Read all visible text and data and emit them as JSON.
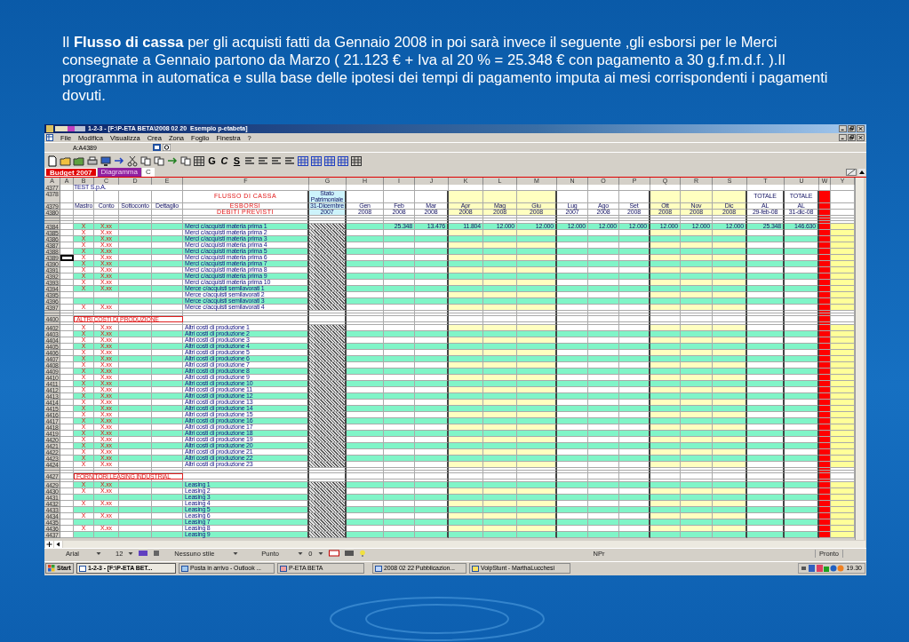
{
  "intro": "Il **Flusso di cassa** per gli acquisti fatti da Gennaio 2008 in poi sarà invece il seguente ,gli esborsi per le Merci consegnate a Gennaio partono da Marzo ( 21.123 € + Iva al 20 % = 25.348 € con pagamento a 30 g.f.m.d.f. ).Il programma in automatica e sulla base delle ipotesi dei tempi di pagamento imputa ai mesi corrispondenti i pagamenti dovuti.",
  "window": {
    "title": "1-2-3 - [F:\\P-ETA BETA\\2008 02 20  Esempio p-etabeta]"
  },
  "menu": [
    "File",
    "Modifica",
    "Visualizza",
    "Crea",
    "Zona",
    "Foglio",
    "Finestra",
    "?"
  ],
  "address": "A:A4389",
  "format_buttons": [
    "G",
    "C",
    "S"
  ],
  "sheet_tabs": [
    {
      "label": "Budget 2007",
      "selected": true,
      "color": "#e00000"
    },
    {
      "label": "Diagramma",
      "selected": false,
      "color": "#9020a0"
    },
    {
      "label": "C",
      "selected": false,
      "color": "#ffffff"
    }
  ],
  "column_headers": [
    "A",
    "A",
    "B",
    "C",
    "D",
    "E",
    "F",
    "G",
    "H",
    "I",
    "J",
    "K",
    "L",
    "M",
    "N",
    "O",
    "P",
    "Q",
    "R",
    "S",
    "T",
    "U",
    "W",
    "Y"
  ],
  "rows": [
    {
      "n": "4377",
      "kind": "title",
      "cells": {
        "B": "TEST S.p.A."
      }
    },
    {
      "n": "4378",
      "kind": "caption",
      "cells": {
        "F": "FLUSSO DI CASSA",
        "G": "Stato Patrimoniale",
        "T": "TOTALE",
        "U": "TOTALE"
      }
    },
    {
      "n": "4379",
      "kind": "header",
      "cells": {
        "B": "Mastro",
        "C": "Conto",
        "D": "Sottoconto",
        "E": "Dettaglio",
        "F": "ESBORSI",
        "G": "31-Dicembre",
        "H": "Gen",
        "I": "Feb",
        "J": "Mar",
        "K": "Apr",
        "L": "Mag",
        "M": "Giu",
        "N": "Lug",
        "O": "Ago",
        "P": "Set",
        "Q": "Ott",
        "R": "Nov",
        "S": "Dic",
        "T": "AL",
        "U": "AL"
      }
    },
    {
      "n": "4380",
      "kind": "header",
      "cells": {
        "F": "DEBITI PREVISTI",
        "G": "2007",
        "H": "2008",
        "I": "2008",
        "J": "2008",
        "K": "2008",
        "L": "2008",
        "M": "2008",
        "N": "2007",
        "O": "2008",
        "P": "2008",
        "Q": "2008",
        "R": "2008",
        "S": "2008",
        "T": "29-feb-08",
        "U": "31-dic-08"
      }
    },
    {
      "kind": "gap"
    },
    {
      "kind": "gap"
    },
    {
      "kind": "gap"
    },
    {
      "n": "4384",
      "kind": "data",
      "highlighted": true,
      "selected": false,
      "cells": {
        "B": "X",
        "C": "X.xx",
        "F": "Merci c/acquisti materia prima 1",
        "I": "25.348",
        "J": "13.476",
        "K": "11.804",
        "L": "12.000",
        "M": "12.000",
        "N": "12.000",
        "O": "12.000",
        "P": "12.000",
        "Q": "12.000",
        "R": "12.000",
        "S": "12.000",
        "T": "25.348",
        "U": "146.630"
      }
    },
    {
      "n": "4385",
      "kind": "data",
      "highlighted": false,
      "selected": false,
      "cells": {
        "B": "X",
        "C": "X.xx",
        "F": "Merci c/acquisti materia prima 2"
      }
    },
    {
      "n": "4386",
      "kind": "data",
      "highlighted": true,
      "selected": false,
      "cells": {
        "B": "X",
        "C": "X.xx",
        "F": "Merci c/acquisti materia prima 3"
      }
    },
    {
      "n": "4387",
      "kind": "data",
      "highlighted": false,
      "selected": false,
      "cells": {
        "B": "X",
        "C": "X.xx",
        "F": "Merci c/acquisti materia prima 4"
      }
    },
    {
      "n": "4388",
      "kind": "data",
      "highlighted": true,
      "selected": false,
      "cells": {
        "B": "X",
        "C": "X.xx",
        "F": "Merci c/acquisti materia prima 5"
      }
    },
    {
      "n": "4389",
      "kind": "data",
      "highlighted": false,
      "selected": true,
      "cells": {
        "B": "X",
        "C": "X.xx",
        "F": "Merci c/acquisti materia prima 6"
      }
    },
    {
      "n": "4390",
      "kind": "data",
      "highlighted": true,
      "selected": false,
      "cells": {
        "B": "X",
        "C": "X.xx",
        "F": "Merci c/acquisti materia prima 7"
      }
    },
    {
      "n": "4391",
      "kind": "data",
      "highlighted": false,
      "selected": false,
      "cells": {
        "B": "X",
        "C": "X.xx",
        "F": "Merci c/acquisti materia prima 8"
      }
    },
    {
      "n": "4392",
      "kind": "data",
      "highlighted": true,
      "selected": false,
      "cells": {
        "B": "X",
        "C": "X.xx",
        "F": "Merci c/acquisti materia prima 9"
      }
    },
    {
      "n": "4393",
      "kind": "data",
      "highlighted": false,
      "selected": false,
      "cells": {
        "B": "X",
        "C": "X.xx",
        "F": "Merci c/acquisti materia prima 10"
      }
    },
    {
      "n": "4394",
      "kind": "data",
      "highlighted": true,
      "selected": false,
      "cells": {
        "B": "X",
        "C": "X.xx",
        "F": "Merce c/acquisti semilavorati 1"
      }
    },
    {
      "n": "4395",
      "kind": "data",
      "highlighted": false,
      "selected": false,
      "cells": {
        "F": "Merce c/acquisti semilavorati 2"
      }
    },
    {
      "n": "4396",
      "kind": "data",
      "highlighted": true,
      "selected": false,
      "cells": {
        "F": "Merce c/acquisti semilavorati 3"
      }
    },
    {
      "n": "4397",
      "kind": "data",
      "highlighted": false,
      "selected": false,
      "cells": {
        "B": "X",
        "C": "X.xx",
        "F": "Merce c/acquisti semilavorati 4"
      }
    },
    {
      "kind": "gap"
    },
    {
      "kind": "gap"
    },
    {
      "n": "4400",
      "kind": "section",
      "cells": {
        "B": "ALTRI COSTI DI PRODUZIONE"
      }
    },
    {
      "kind": "gap"
    },
    {
      "n": "4402",
      "kind": "data",
      "highlighted": false,
      "selected": false,
      "cells": {
        "B": "X",
        "C": "X.xx",
        "F": "Altri costi di produzione 1"
      }
    },
    {
      "n": "4403",
      "kind": "data",
      "highlighted": true,
      "selected": false,
      "cells": {
        "B": "X",
        "C": "X.xx",
        "F": "Altri costi di produzione 2"
      }
    },
    {
      "n": "4404",
      "kind": "data",
      "highlighted": false,
      "selected": false,
      "cells": {
        "B": "X",
        "C": "X.xx",
        "F": "Altri costi di produzione 3"
      }
    },
    {
      "n": "4405",
      "kind": "data",
      "highlighted": true,
      "selected": false,
      "cells": {
        "B": "X",
        "C": "X.xx",
        "F": "Altri costi di produzione 4"
      }
    },
    {
      "n": "4406",
      "kind": "data",
      "highlighted": false,
      "selected": false,
      "cells": {
        "B": "X",
        "C": "X.xx",
        "F": "Altri costi di produzione 5"
      }
    },
    {
      "n": "4407",
      "kind": "data",
      "highlighted": true,
      "selected": false,
      "cells": {
        "B": "X",
        "C": "X.xx",
        "F": "Altri costi di produzione 6"
      }
    },
    {
      "n": "4408",
      "kind": "data",
      "highlighted": false,
      "selected": false,
      "cells": {
        "B": "X",
        "C": "X.xx",
        "F": "Altri costi di produzione 7"
      }
    },
    {
      "n": "4409",
      "kind": "data",
      "highlighted": true,
      "selected": false,
      "cells": {
        "B": "X",
        "C": "X.xx",
        "F": "Altri costi di produzione 8"
      }
    },
    {
      "n": "4410",
      "kind": "data",
      "highlighted": false,
      "selected": false,
      "cells": {
        "B": "X",
        "C": "X.xx",
        "F": "Altri costi di produzione 9"
      }
    },
    {
      "n": "4411",
      "kind": "data",
      "highlighted": true,
      "selected": false,
      "cells": {
        "B": "X",
        "C": "X.xx",
        "F": "Altri costi di produzione 10"
      }
    },
    {
      "n": "4412",
      "kind": "data",
      "highlighted": false,
      "selected": false,
      "cells": {
        "B": "X",
        "C": "X.xx",
        "F": "Altri costi di produzione 11"
      }
    },
    {
      "n": "4413",
      "kind": "data",
      "highlighted": true,
      "selected": false,
      "cells": {
        "B": "X",
        "C": "X.xx",
        "F": "Altri costi di produzione 12"
      }
    },
    {
      "n": "4414",
      "kind": "data",
      "highlighted": false,
      "selected": false,
      "cells": {
        "B": "X",
        "C": "X.xx",
        "F": "Altri costi di produzione 13"
      }
    },
    {
      "n": "4415",
      "kind": "data",
      "highlighted": true,
      "selected": false,
      "cells": {
        "B": "X",
        "C": "X.xx",
        "F": "Altri costi di produzione 14"
      }
    },
    {
      "n": "4416",
      "kind": "data",
      "highlighted": false,
      "selected": false,
      "cells": {
        "B": "X",
        "C": "X.xx",
        "F": "Altri costi di produzione 15"
      }
    },
    {
      "n": "4417",
      "kind": "data",
      "highlighted": true,
      "selected": false,
      "cells": {
        "B": "X",
        "C": "X.xx",
        "F": "Altri costi di produzione 16"
      }
    },
    {
      "n": "4418",
      "kind": "data",
      "highlighted": false,
      "selected": false,
      "cells": {
        "B": "X",
        "C": "X.xx",
        "F": "Altri costi di produzione 17"
      }
    },
    {
      "n": "4419",
      "kind": "data",
      "highlighted": true,
      "selected": false,
      "cells": {
        "B": "X",
        "C": "X.xx",
        "F": "Altri costi di produzione 18"
      }
    },
    {
      "n": "4420",
      "kind": "data",
      "highlighted": false,
      "selected": false,
      "cells": {
        "B": "X",
        "C": "X.xx",
        "F": "Altri costi di produzione 19"
      }
    },
    {
      "n": "4421",
      "kind": "data",
      "highlighted": true,
      "selected": false,
      "cells": {
        "B": "X",
        "C": "X.xx",
        "F": "Altri costi di produzione 20"
      }
    },
    {
      "n": "4422",
      "kind": "data",
      "highlighted": false,
      "selected": false,
      "cells": {
        "B": "X",
        "C": "X.xx",
        "F": "Altri costi di produzione 21"
      }
    },
    {
      "n": "4423",
      "kind": "data",
      "highlighted": true,
      "selected": false,
      "cells": {
        "B": "X",
        "C": "X.xx",
        "F": "Altri costi di produzione 22"
      }
    },
    {
      "n": "4424",
      "kind": "data",
      "highlighted": false,
      "selected": false,
      "cells": {
        "B": "X",
        "C": "X.xx",
        "F": "Altri costi di produzione 23"
      }
    },
    {
      "kind": "gap"
    },
    {
      "kind": "gap"
    },
    {
      "n": "4427",
      "kind": "section",
      "cells": {
        "B": "FORNITORI LEASING INDUSTRIAL"
      }
    },
    {
      "kind": "gap"
    },
    {
      "n": "4429",
      "kind": "data",
      "highlighted": true,
      "selected": false,
      "cells": {
        "B": "X",
        "C": "X.xx",
        "F": "Leasing 1"
      }
    },
    {
      "n": "4430",
      "kind": "data",
      "highlighted": false,
      "selected": false,
      "cells": {
        "B": "X",
        "C": "X.xx",
        "F": "Leasing 2"
      }
    },
    {
      "n": "4431",
      "kind": "data",
      "highlighted": true,
      "selected": false,
      "cells": {
        "F": "Leasing 3"
      }
    },
    {
      "n": "4432",
      "kind": "data",
      "highlighted": false,
      "selected": false,
      "cells": {
        "B": "X",
        "C": "X.xx",
        "F": "Leasing 4"
      }
    },
    {
      "n": "4433",
      "kind": "data",
      "highlighted": true,
      "selected": false,
      "cells": {
        "F": "Leasing 5"
      }
    },
    {
      "n": "4434",
      "kind": "data",
      "highlighted": false,
      "selected": false,
      "cells": {
        "B": "X",
        "C": "X.xx",
        "F": "Leasing 6"
      }
    },
    {
      "n": "4435",
      "kind": "data",
      "highlighted": true,
      "selected": false,
      "cells": {
        "F": "Leasing 7"
      }
    },
    {
      "n": "4436",
      "kind": "data",
      "highlighted": false,
      "selected": false,
      "cells": {
        "B": "X",
        "C": "X.xx",
        "F": "Leasing 8"
      }
    },
    {
      "n": "4437",
      "kind": "data",
      "highlighted": true,
      "selected": false,
      "cells": {
        "F": "Leasing 9"
      }
    }
  ],
  "status_bar": {
    "font": "Arial",
    "size": "12",
    "style": "Nessuno stile",
    "unit": "Punto",
    "number": "0",
    "mode_1": "NPr",
    "mode_2": "Pronto"
  },
  "taskbar": {
    "start": "Start",
    "tasks": [
      {
        "label": "1-2-3 - [F:\\P-ETA BET...",
        "selected": true
      },
      {
        "label": "Posta in arrivo - Outlook ...",
        "selected": false
      },
      {
        "label": "P-ETA BETA",
        "selected": false
      },
      {
        "label": "2008 02 22 Pubblicazion...",
        "selected": false
      },
      {
        "label": "VoipStunt - MarthaLucchesi",
        "selected": false
      }
    ],
    "clock": "19.30"
  }
}
